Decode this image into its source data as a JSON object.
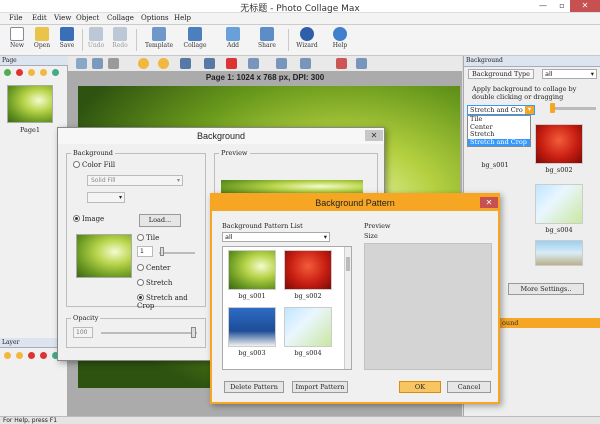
{
  "window": {
    "title": "无标题 - Photo Collage Max",
    "min": "—",
    "max": "▫",
    "close": "✕"
  },
  "menu": [
    "File",
    "Edit",
    "View",
    "Object",
    "Collage",
    "Options",
    "Help"
  ],
  "toolbar": [
    {
      "label": "New",
      "icon": "new-document-icon",
      "enabled": true
    },
    {
      "label": "Open",
      "icon": "open-folder-icon",
      "enabled": true
    },
    {
      "label": "Save",
      "icon": "save-icon",
      "enabled": true
    },
    {
      "label": "Undo",
      "icon": "undo-icon",
      "enabled": false
    },
    {
      "label": "Redo",
      "icon": "redo-icon",
      "enabled": false
    },
    {
      "label": "Template",
      "icon": "template-icon",
      "enabled": true
    },
    {
      "label": "Collage",
      "icon": "collage-icon",
      "enabled": true
    },
    {
      "label": "Add",
      "icon": "add-icon",
      "enabled": true
    },
    {
      "label": "Share",
      "icon": "share-icon",
      "enabled": true
    },
    {
      "label": "Wizard",
      "icon": "wizard-icon",
      "enabled": true
    },
    {
      "label": "Help",
      "icon": "help-icon",
      "enabled": true
    }
  ],
  "page_panel": {
    "header": "Page",
    "page_label": "Page1"
  },
  "layer_panel": {
    "header": "Layer"
  },
  "canvas": {
    "page_info": "Page 1: 1024 x 768 px, DPI: 300"
  },
  "right_panel": {
    "header": "Background",
    "type_label": "Background Type",
    "type_value": "all",
    "hint": "Apply background to collage by double clicking or dragging",
    "mode_value": "Stretch and Cro",
    "mode_options": [
      "Tile",
      "Center",
      "Stretch",
      "Stretch and Crop"
    ],
    "mode_selected": "Stretch and Crop",
    "thumbs": [
      "bg_s001",
      "bg_s002",
      "bg_s003",
      "bg_s004"
    ],
    "more_button": "More Settings..",
    "section_label": "ound"
  },
  "bg_dialog": {
    "title": "Background",
    "background_group": "Background",
    "color_fill": "Color Fill",
    "fill_select": "Solid Fill",
    "image": "Image",
    "load_button": "Load...",
    "tile": "Tile",
    "tile_value": "1",
    "center": "Center",
    "stretch": "Stretch",
    "stretch_crop": "Stretch and Crop",
    "opacity_group": "Opacity",
    "opacity_value": "100",
    "opacity": 1.0,
    "preview_group": "Preview"
  },
  "pattern_dialog": {
    "title": "Background Pattern",
    "list_label": "Background Pattern List",
    "filter_value": "all",
    "preview_label": "Preview",
    "size_label": "Size",
    "items": [
      "bg_s001",
      "bg_s002",
      "bg_s003",
      "bg_s004"
    ],
    "delete_button": "Delete Pattern",
    "import_button": "Import Pattern",
    "ok_button": "OK",
    "cancel_button": "Cancel"
  },
  "status": {
    "text": "For Help, press F1"
  },
  "colors": {
    "accent": "#f6a623",
    "selection": "#3399ff",
    "title_close": "#c75050"
  }
}
